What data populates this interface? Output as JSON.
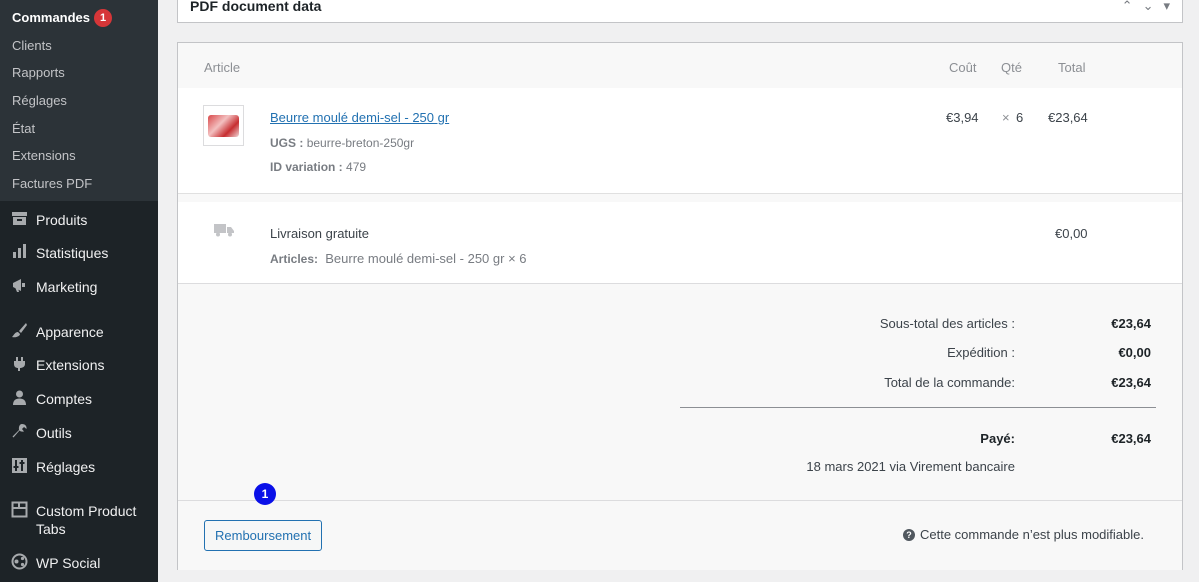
{
  "sidebar": {
    "submenu": [
      {
        "label": "Commandes",
        "badge": "1"
      },
      {
        "label": "Clients"
      },
      {
        "label": "Rapports"
      },
      {
        "label": "Réglages"
      },
      {
        "label": "État"
      },
      {
        "label": "Extensions"
      },
      {
        "label": "Factures PDF"
      }
    ],
    "menu": [
      {
        "label": "Produits",
        "icon": "archive-icon"
      },
      {
        "label": "Statistiques",
        "icon": "bar-chart-icon"
      },
      {
        "label": "Marketing",
        "icon": "megaphone-icon"
      },
      {
        "label": "Apparence",
        "icon": "paintbrush-icon"
      },
      {
        "label": "Extensions",
        "icon": "plugin-icon"
      },
      {
        "label": "Comptes",
        "icon": "user-icon"
      },
      {
        "label": "Outils",
        "icon": "wrench-icon"
      },
      {
        "label": "Réglages",
        "icon": "settings-icon"
      },
      {
        "label": "Custom Product Tabs",
        "icon": "tabs-icon"
      },
      {
        "label": "WP Social",
        "icon": "share-icon"
      }
    ]
  },
  "top_box": {
    "title": "PDF document data"
  },
  "items": {
    "headers": {
      "article": "Article",
      "cost": "Coût",
      "qty": "Qté",
      "total": "Total"
    },
    "product": {
      "name": "Beurre moulé demi-sel - 250 gr",
      "sku_label": "UGS :",
      "sku": "beurre-breton-250gr",
      "variation_label": "ID variation :",
      "variation_id": "479",
      "cost": "€3,94",
      "qty_sign": "×",
      "qty": "6",
      "total": "€23,64"
    },
    "shipping": {
      "name": "Livraison gratuite",
      "articles_label": "Articles:",
      "articles": "Beurre moulé demi-sel - 250 gr × 6",
      "total": "€0,00"
    }
  },
  "totals": {
    "subtotal_label": "Sous-total des articles :",
    "subtotal": "€23,64",
    "shipping_label": "Expédition :",
    "shipping": "€0,00",
    "order_total_label": "Total de la commande:",
    "order_total": "€23,64",
    "paid_label": "Payé:",
    "paid": "€23,64",
    "paid_note": "18 mars 2021 via Virement bancaire"
  },
  "actions": {
    "refund_label": "Remboursement",
    "locked_note": "Cette commande n’est plus modifiable."
  },
  "annotation": {
    "marker": "1"
  },
  "colors": {
    "accent": "#2271b1",
    "badge": "#d63638",
    "marker": "#0a10e8",
    "sidebar": "#1d2327"
  }
}
